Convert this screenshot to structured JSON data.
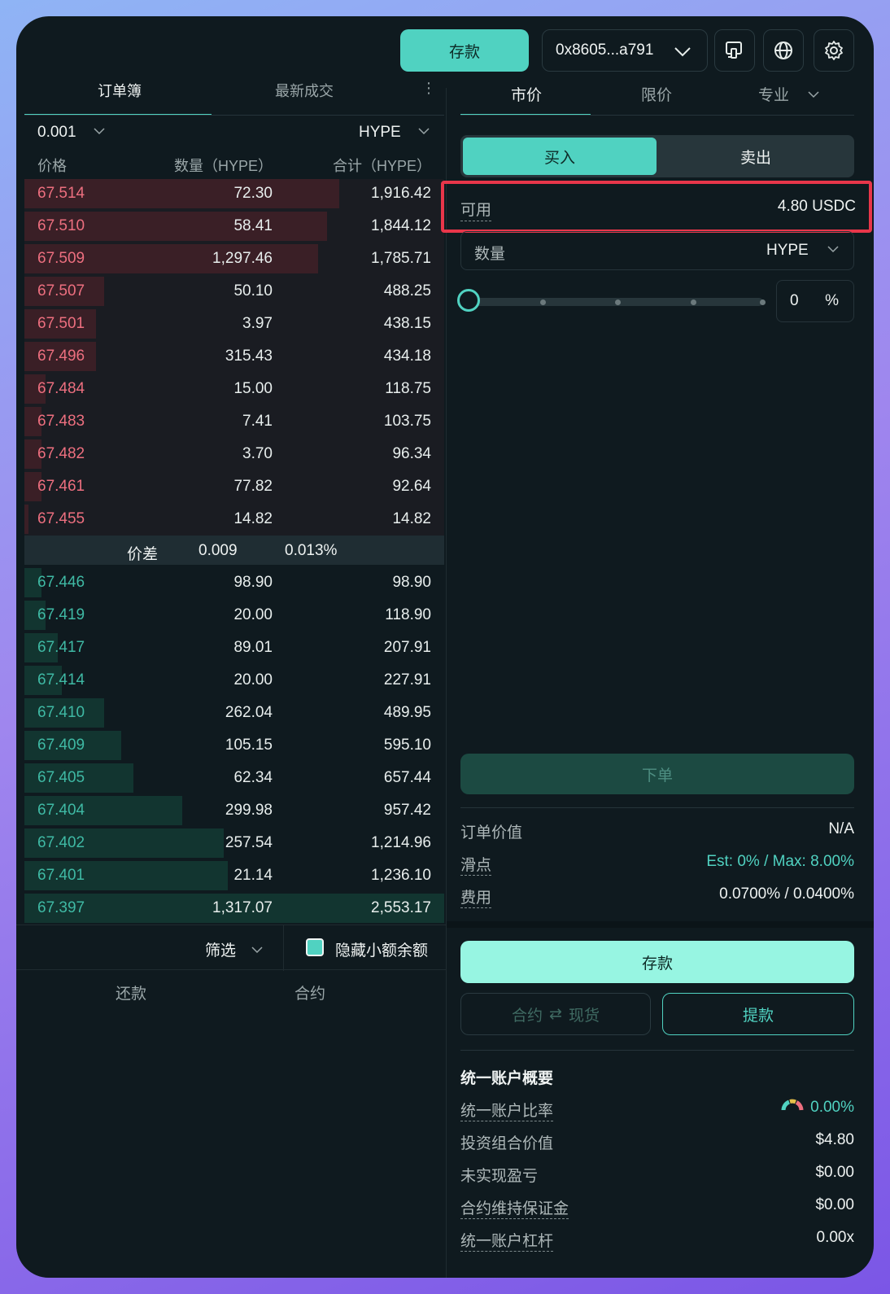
{
  "header": {
    "deposit_label": "存款",
    "wallet_address": "0x8605...a791"
  },
  "orderbook": {
    "tabs": [
      "订单簿",
      "最新成交"
    ],
    "tick_size": "0.001",
    "coin": "HYPE",
    "columns": [
      "价格",
      "数量（HYPE）",
      "合计（HYPE）"
    ],
    "asks": [
      {
        "price": "67.514",
        "size": "72.30",
        "total": "1,916.42",
        "depth": 0.75
      },
      {
        "price": "67.510",
        "size": "58.41",
        "total": "1,844.12",
        "depth": 0.72
      },
      {
        "price": "67.509",
        "size": "1,297.46",
        "total": "1,785.71",
        "depth": 0.7
      },
      {
        "price": "67.507",
        "size": "50.10",
        "total": "488.25",
        "depth": 0.19
      },
      {
        "price": "67.501",
        "size": "3.97",
        "total": "438.15",
        "depth": 0.17
      },
      {
        "price": "67.496",
        "size": "315.43",
        "total": "434.18",
        "depth": 0.17
      },
      {
        "price": "67.484",
        "size": "15.00",
        "total": "118.75",
        "depth": 0.05
      },
      {
        "price": "67.483",
        "size": "7.41",
        "total": "103.75",
        "depth": 0.04
      },
      {
        "price": "67.482",
        "size": "3.70",
        "total": "96.34",
        "depth": 0.04
      },
      {
        "price": "67.461",
        "size": "77.82",
        "total": "92.64",
        "depth": 0.04
      },
      {
        "price": "67.455",
        "size": "14.82",
        "total": "14.82",
        "depth": 0.01
      }
    ],
    "spread": {
      "label": "价差",
      "value": "0.009",
      "percent": "0.013%"
    },
    "bids": [
      {
        "price": "67.446",
        "size": "98.90",
        "total": "98.90",
        "depth": 0.04
      },
      {
        "price": "67.419",
        "size": "20.00",
        "total": "118.90",
        "depth": 0.05
      },
      {
        "price": "67.417",
        "size": "89.01",
        "total": "207.91",
        "depth": 0.08
      },
      {
        "price": "67.414",
        "size": "20.00",
        "total": "227.91",
        "depth": 0.09
      },
      {
        "price": "67.410",
        "size": "262.04",
        "total": "489.95",
        "depth": 0.19
      },
      {
        "price": "67.409",
        "size": "105.15",
        "total": "595.10",
        "depth": 0.23
      },
      {
        "price": "67.405",
        "size": "62.34",
        "total": "657.44",
        "depth": 0.26
      },
      {
        "price": "67.404",
        "size": "299.98",
        "total": "957.42",
        "depth": 0.375
      },
      {
        "price": "67.402",
        "size": "257.54",
        "total": "1,214.96",
        "depth": 0.475
      },
      {
        "price": "67.401",
        "size": "21.14",
        "total": "1,236.10",
        "depth": 0.485
      },
      {
        "price": "67.397",
        "size": "1,317.07",
        "total": "2,553.17",
        "depth": 1.0
      }
    ]
  },
  "bottom_left": {
    "filter_label": "筛选",
    "hide_small_label": "隐藏小额余额",
    "tabs": [
      "还款",
      "合约"
    ]
  },
  "trade": {
    "order_tabs": [
      "市价",
      "限价",
      "专业"
    ],
    "buy_label": "买入",
    "sell_label": "卖出",
    "available_label": "可用",
    "available_value": "4.80 USDC",
    "quantity_label": "数量",
    "quantity_unit": "HYPE",
    "percent_value": "0",
    "percent_sign": "%",
    "slider_fraction": 0,
    "place_order_label": "下单",
    "order_value_label": "订单价值",
    "order_value": "N/A",
    "slippage_label": "滑点",
    "slippage_value": "Est: 0% / Max: 8.00%",
    "fee_label": "费用",
    "fee_value": "0.0700% / 0.0400%"
  },
  "account": {
    "deposit_label": "存款",
    "transfer_left": "合约",
    "transfer_right": "现货",
    "withdraw_label": "提款",
    "summary_title": "统一账户概要",
    "rows": [
      {
        "label": "统一账户比率",
        "value": "0.00%"
      },
      {
        "label": "投资组合价值",
        "value": "$4.80"
      },
      {
        "label": "未实现盈亏",
        "value": "$0.00"
      },
      {
        "label": "合约维持保证金",
        "value": "$0.00"
      },
      {
        "label": "统一账户杠杆",
        "value": "0.00x"
      }
    ]
  },
  "colors": {
    "accent": "#50d2c1",
    "ask": "#ed6f7f",
    "bid": "#3fb9a4",
    "highlight_box": "#e8364a"
  }
}
